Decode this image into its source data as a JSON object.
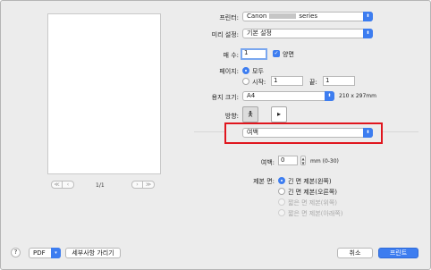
{
  "preview": {
    "page_indicator": "1/1",
    "nav_first_icon": "≪",
    "nav_prev_icon": "‹",
    "nav_next_icon": "›",
    "nav_last_icon": "≫"
  },
  "printer": {
    "label": "프린터:",
    "value_prefix": "Canon",
    "value_suffix": "series"
  },
  "presets": {
    "label": "미리 설정:",
    "value": "기본 설정"
  },
  "copies": {
    "label": "매 수:",
    "value": "1",
    "duplex_label": "양면",
    "duplex_checked": true
  },
  "pages": {
    "label": "페이지:",
    "all_label": "모두",
    "from_label": "시작:",
    "from_value": "1",
    "to_label": "끝:",
    "to_value": "1"
  },
  "paper_size": {
    "label": "용지 크기:",
    "value": "A4",
    "dimensions": "210 x 297mm"
  },
  "orientation": {
    "label": "방향:"
  },
  "section": {
    "value": "여백"
  },
  "margin": {
    "label": "여백:",
    "value": "0",
    "range": "mm (0-30)"
  },
  "stapling": {
    "label": "제본 면:",
    "options": [
      {
        "label": "긴 면 제본(왼쪽)",
        "selected": true,
        "disabled": false
      },
      {
        "label": "긴 면 제본(오른쪽)",
        "selected": false,
        "disabled": false
      },
      {
        "label": "짧은 면 제본(위쪽)",
        "selected": false,
        "disabled": true
      },
      {
        "label": "짧은 면 제본(아래쪽)",
        "selected": false,
        "disabled": true
      }
    ]
  },
  "footer": {
    "help_label": "?",
    "pdf_label": "PDF",
    "hide_details_label": "세부사항 가리기",
    "cancel_label": "취소",
    "print_label": "프린트"
  },
  "colors": {
    "accent": "#3d7df0",
    "highlight": "#e0161e"
  }
}
